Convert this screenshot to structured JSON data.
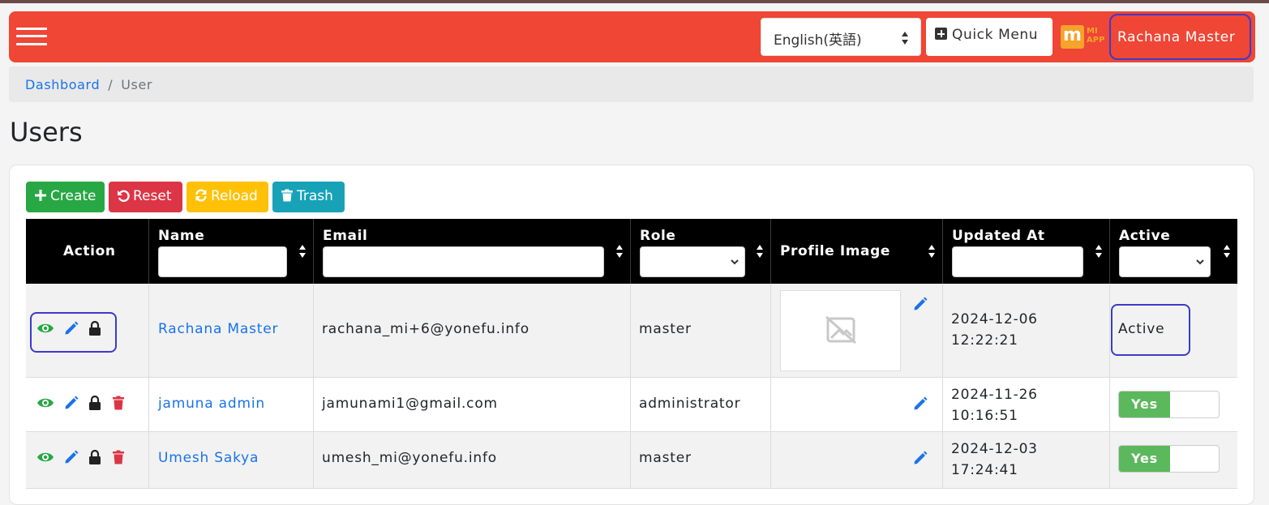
{
  "header": {
    "language": "English(英語)",
    "quick_menu": "Quick Menu",
    "logo_text": [
      "MI",
      "APP"
    ],
    "user": "Rachana Master",
    "colors": {
      "header_bg": "#ef4635",
      "highlight": "#3b3bc9"
    }
  },
  "breadcrumb": {
    "home": "Dashboard",
    "separator": "/",
    "current": "User"
  },
  "page": {
    "title": "Users"
  },
  "toolbar": {
    "create": "Create",
    "reset": "Reset",
    "reload": "Reload",
    "trash": "Trash"
  },
  "table": {
    "columns": {
      "action": "Action",
      "name": "Name",
      "email": "Email",
      "role": "Role",
      "profile_image": "Profile Image",
      "updated_at": "Updated At",
      "active": "Active"
    },
    "rows": [
      {
        "name": "Rachana Master",
        "email": "rachana_mi+6@yonefu.info",
        "role": "master",
        "updated_date": "2024-12-06",
        "updated_time": "12:22:21",
        "active_text": "Active"
      },
      {
        "name": "jamuna admin",
        "email": "jamunami1@gmail.com",
        "role": "administrator",
        "updated_date": "2024-11-26",
        "updated_time": "10:16:51",
        "active_toggle": "Yes"
      },
      {
        "name": "Umesh Sakya",
        "email": "umesh_mi@yonefu.info",
        "role": "master",
        "updated_date": "2024-12-03",
        "updated_time": "17:24:41",
        "active_toggle": "Yes"
      }
    ]
  }
}
